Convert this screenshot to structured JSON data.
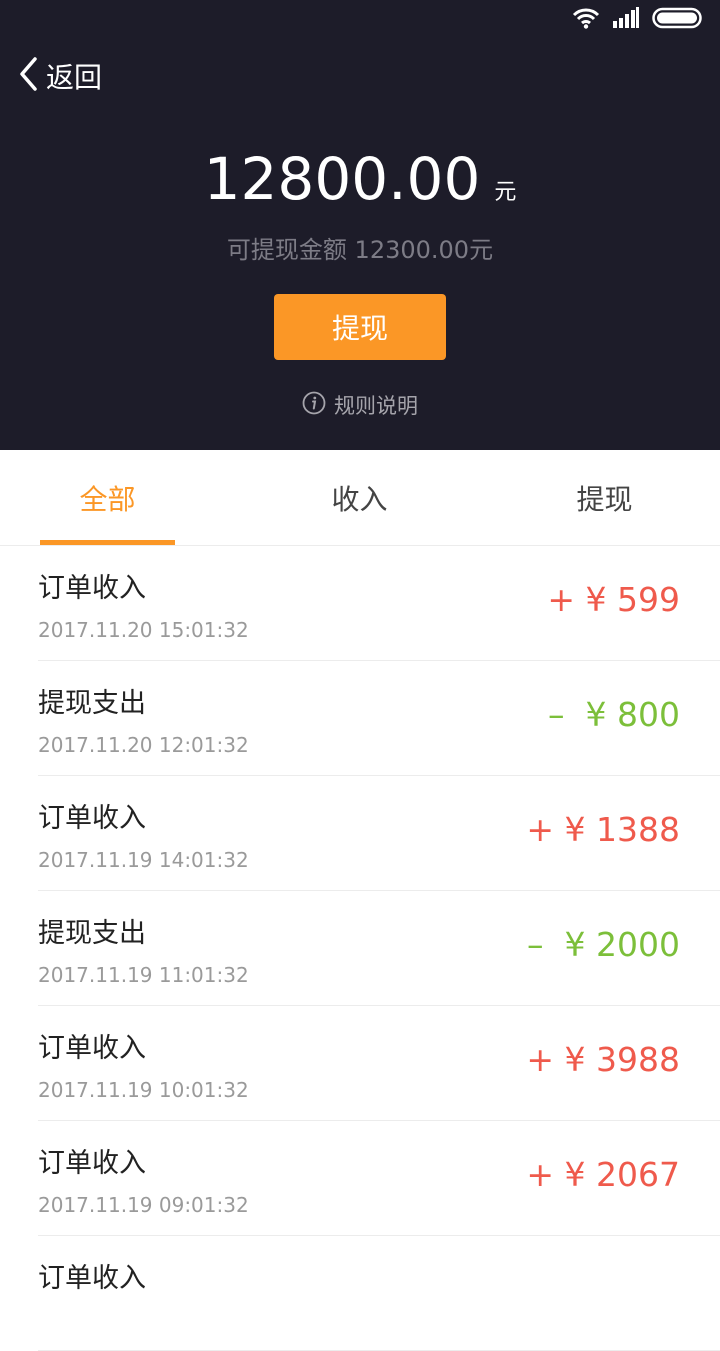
{
  "header": {
    "back_label": "返回",
    "balance_amount": "12800.00",
    "balance_unit": "元",
    "withdrawable_text": "可提现金额 12300.00元",
    "withdraw_button": "提现",
    "rules_label": "规则说明",
    "bg_color": "#1d1c29",
    "accent_color": "#fb9726"
  },
  "tabs": [
    {
      "label": "全部",
      "active": true
    },
    {
      "label": "收入",
      "active": false
    },
    {
      "label": "提现",
      "active": false
    }
  ],
  "transactions": [
    {
      "title": "订单收入",
      "time": "2017.11.20   15:01:32",
      "amount": "+ ¥ 599",
      "type": "income"
    },
    {
      "title": "提现支出",
      "time": "2017.11.20   12:01:32",
      "amount": "–  ¥ 800",
      "type": "expense"
    },
    {
      "title": "订单收入",
      "time": "2017.11.19   14:01:32",
      "amount": "+ ¥ 1388",
      "type": "income"
    },
    {
      "title": "提现支出",
      "time": "2017.11.19   11:01:32",
      "amount": "–  ¥ 2000",
      "type": "expense"
    },
    {
      "title": "订单收入",
      "time": "2017.11.19   10:01:32",
      "amount": "+ ¥ 3988",
      "type": "income"
    },
    {
      "title": "订单收入",
      "time": "2017.11.19   09:01:32",
      "amount": "+ ¥ 2067",
      "type": "income"
    },
    {
      "title": "订单收入",
      "time": "",
      "amount": "",
      "type": "income"
    }
  ],
  "colors": {
    "income": "#ef5a4c",
    "expense": "#7cbf3a"
  }
}
